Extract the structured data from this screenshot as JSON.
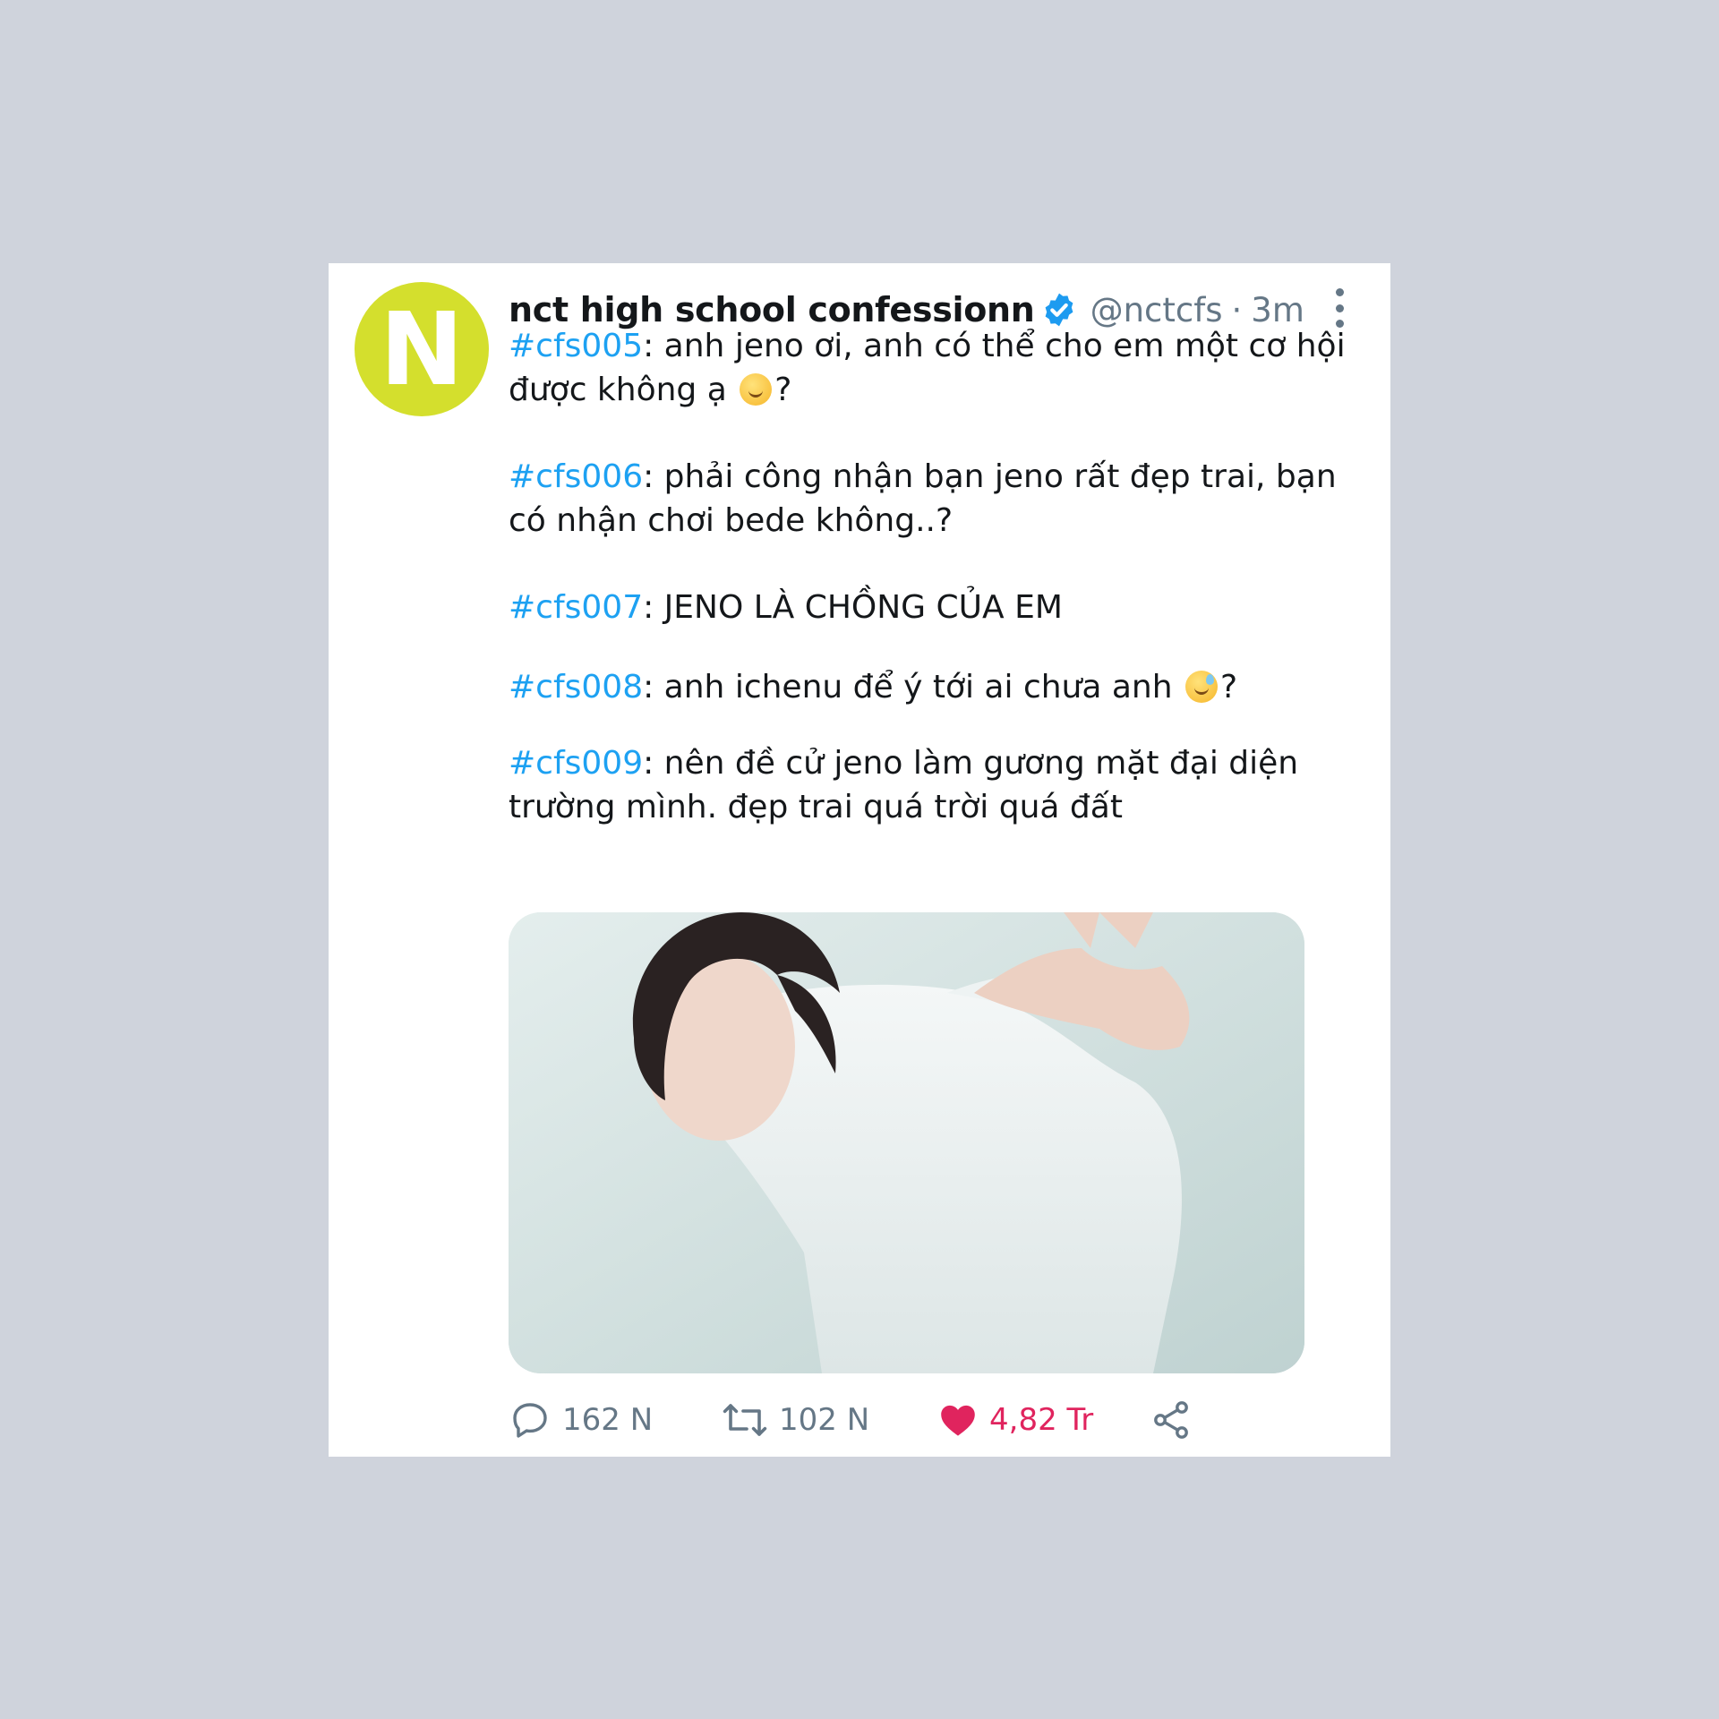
{
  "tweet": {
    "avatar_letter": "N",
    "display_name": "nct high school confessionn",
    "handle": "@nctcfs",
    "separator": "·",
    "time": "3m",
    "colors": {
      "avatar": "#d4df2d",
      "hashtag": "#1da1f2",
      "like": "#e0245e",
      "verified": "#1d9bf0",
      "muted": "#657786"
    },
    "icons": {
      "verified": "verified-badge-icon",
      "more": "more-vertical-icon",
      "reply": "reply-bubble-icon",
      "retweet": "retweet-icon",
      "like": "heart-icon",
      "share": "share-icon"
    },
    "posts": [
      {
        "tag": "#cfs005",
        "text_a": ": anh jeno ơi, anh có thể cho em một cơ hội được không ạ ",
        "emoji": "pleading-face",
        "text_b": "?"
      },
      {
        "tag": "#cfs006",
        "text_a": ": phải công nhận bạn jeno rất đẹp trai, bạn có nhận chơi bede không..?"
      },
      {
        "tag": "#cfs007",
        "text_a": ": JENO LÀ CHỒNG CỦA EM"
      },
      {
        "tag": "#cfs008",
        "text_a": ": anh ichenu để ý tới ai chưa anh ",
        "emoji": "grinning-sweat-face",
        "text_b": "?"
      },
      {
        "tag": "#cfs009",
        "text_a": ": nên đề cử jeno làm gương mặt đại diện trường mình. đẹp trai quá trời quá đất"
      }
    ],
    "stats": {
      "replies": "162 N",
      "retweets": "102 N",
      "likes": "4,82 Tr"
    }
  }
}
